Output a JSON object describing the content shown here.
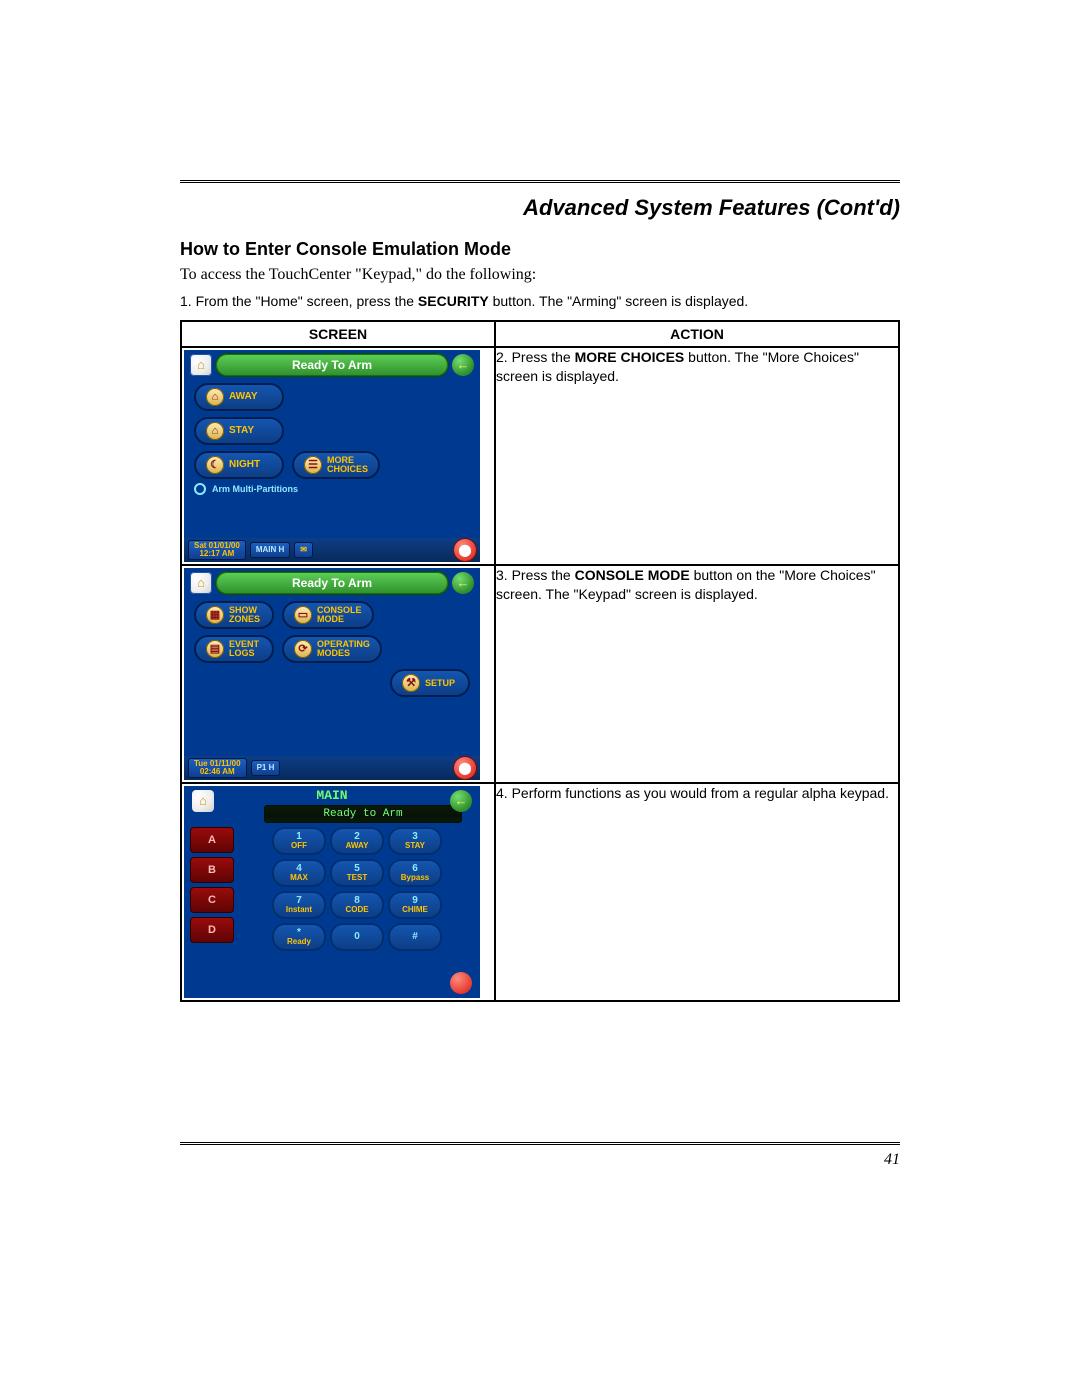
{
  "header": {
    "running_title": "Advanced System Features (Cont'd)"
  },
  "section_title": "How to Enter Console Emulation Mode",
  "intro_text": "To access the TouchCenter \"Keypad,\" do the following:",
  "step1_pre": "1.  From the \"Home\" screen, press the ",
  "step1_bold": "SECURITY",
  "step1_post": " button.  The \"Arming\" screen is displayed.",
  "table": {
    "col_screen": "SCREEN",
    "col_action": "ACTION",
    "rows": [
      {
        "action_pre": "2.  Press the ",
        "action_bold": "MORE CHOICES",
        "action_post": " button.  The \"More Choices\" screen is displayed."
      },
      {
        "action_pre": "3.  Press the ",
        "action_bold": "CONSOLE MODE",
        "action_post": " button on the \"More Choices\" screen.  The \"Keypad\" screen is displayed."
      },
      {
        "action_full": "4.  Perform functions as you would from a regular alpha keypad."
      }
    ]
  },
  "screen1": {
    "ready": "Ready To Arm",
    "away": "AWAY",
    "stay": "STAY",
    "night": "NIGHT",
    "more_choices_l1": "MORE",
    "more_choices_l2": "CHOICES",
    "arm_multi": "Arm Multi-Partitions",
    "ts_l1": "Sat 01/01/00",
    "ts_l2": "12:17 AM",
    "main": "MAIN H"
  },
  "screen2": {
    "ready": "Ready To Arm",
    "show_zones_l1": "SHOW",
    "show_zones_l2": "ZONES",
    "console_l1": "CONSOLE",
    "console_l2": "MODE",
    "event_logs_l1": "EVENT",
    "event_logs_l2": "LOGS",
    "operating_l1": "OPERATING",
    "operating_l2": "MODES",
    "setup": "SETUP",
    "ts_l1": "Tue 01/11/00",
    "ts_l2": "02:46 AM",
    "pt": "P1 H"
  },
  "screen3": {
    "title": "MAIN",
    "lcd": "Ready  to  Arm",
    "abcd": [
      "A",
      "B",
      "C",
      "D"
    ],
    "keys": [
      {
        "n": "1",
        "lbl": "OFF"
      },
      {
        "n": "2",
        "lbl": "AWAY"
      },
      {
        "n": "3",
        "lbl": "STAY"
      },
      {
        "n": "4",
        "lbl": "MAX"
      },
      {
        "n": "5",
        "lbl": "TEST"
      },
      {
        "n": "6",
        "lbl": "Bypass"
      },
      {
        "n": "7",
        "lbl": "Instant"
      },
      {
        "n": "8",
        "lbl": "CODE"
      },
      {
        "n": "9",
        "lbl": "CHIME"
      },
      {
        "n": "*",
        "lbl": "Ready"
      },
      {
        "n": "0",
        "lbl": ""
      },
      {
        "n": "#",
        "lbl": ""
      }
    ]
  },
  "page_number": "41"
}
